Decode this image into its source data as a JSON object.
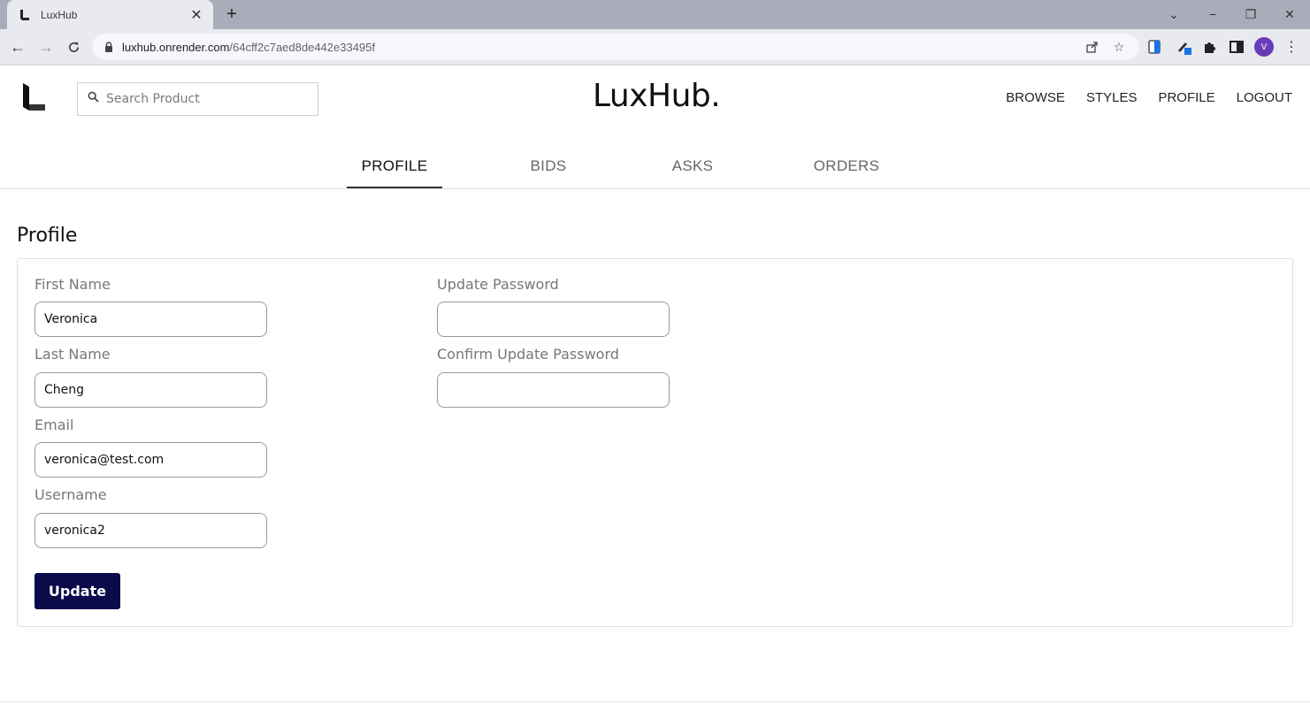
{
  "browser": {
    "tab_title": "LuxHub",
    "url_host": "luxhub.onrender.com",
    "url_path": "/64cff2c7aed8de442e33495f",
    "profile_initial": "V"
  },
  "header": {
    "search_placeholder": "Search Product",
    "brand": "LuxHub.",
    "nav": [
      "BROWSE",
      "STYLES",
      "PROFILE",
      "LOGOUT"
    ]
  },
  "tabs": [
    {
      "label": "PROFILE",
      "active": true
    },
    {
      "label": "BIDS",
      "active": false
    },
    {
      "label": "ASKS",
      "active": false
    },
    {
      "label": "ORDERS",
      "active": false
    }
  ],
  "profile": {
    "title": "Profile",
    "fields": {
      "first_name": {
        "label": "First Name",
        "value": "Veronica"
      },
      "last_name": {
        "label": "Last Name",
        "value": "Cheng"
      },
      "email": {
        "label": "Email",
        "value": "veronica@test.com"
      },
      "username": {
        "label": "Username",
        "value": "veronica2"
      },
      "update_password": {
        "label": "Update Password",
        "value": ""
      },
      "confirm_password": {
        "label": "Confirm Update Password",
        "value": ""
      }
    },
    "update_label": "Update"
  },
  "colors": {
    "button_bg": "#0b0a4a",
    "avatar_bg": "#6a3bb8"
  }
}
